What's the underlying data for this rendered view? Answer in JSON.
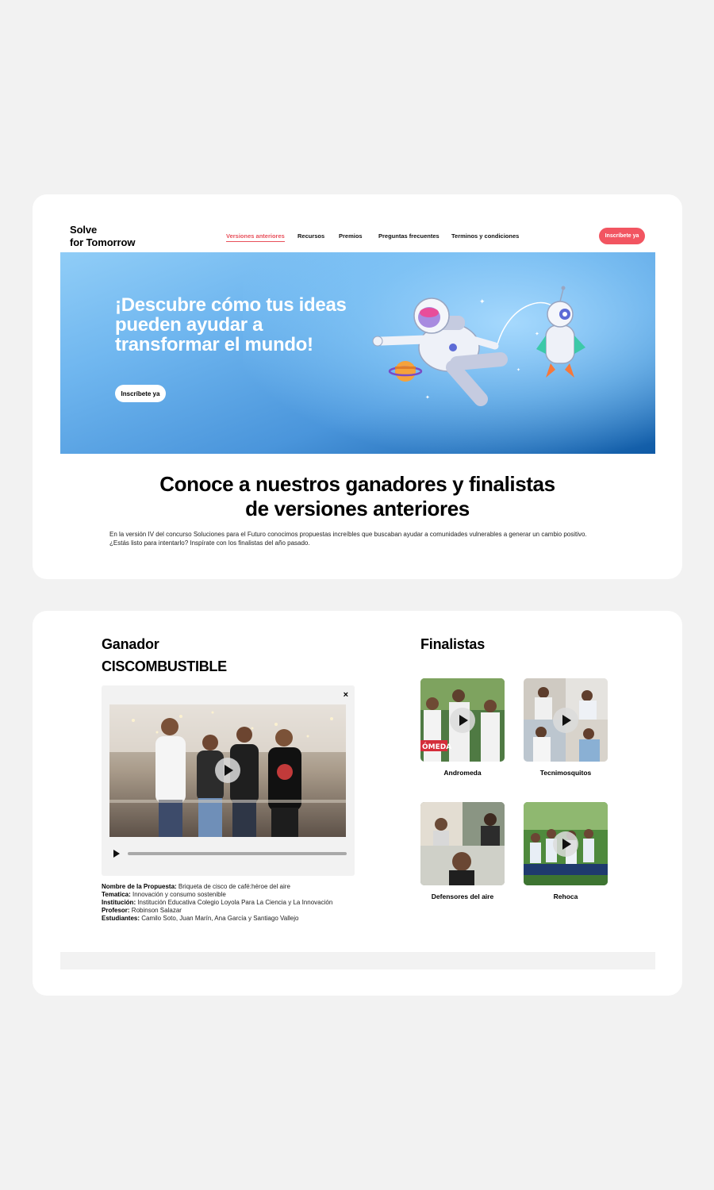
{
  "header": {
    "logo_line1": "Solve",
    "logo_line2": "for Tomorrow",
    "nav": [
      {
        "label": "Versiones anteriores",
        "active": true
      },
      {
        "label": "Recursos",
        "active": false
      },
      {
        "label": "Premios",
        "active": false
      },
      {
        "label": "Preguntas frecuentes",
        "active": false
      },
      {
        "label": "Terminos y condiciones",
        "active": false
      }
    ],
    "cta_label": "Inscríbete ya"
  },
  "hero": {
    "title": "¡Descubre cómo tus ideas pueden ayudar a transformar el mundo!",
    "button_label": "Inscríbete ya"
  },
  "section": {
    "title_line1": "Conoce a nuestros ganadores y finalistas",
    "title_line2": "de versiones anteriores",
    "intro_line1": "En la versión IV del concurso Soluciones para el Futuro conocimos propuestas increíbles que buscaban ayudar a comunidades vulnerables a generar un cambio positivo.",
    "intro_line2": "¿Estás listo para intentarlo? Inspírate con los finalistas del año pasado."
  },
  "winner": {
    "heading": "Ganador",
    "name": "CISCOMBUSTIBLE",
    "close_icon": "×",
    "details": [
      {
        "label": "Nombre de la Propuesta:",
        "value": " Briqueta de cisco de café:héroe del aire"
      },
      {
        "label": "Tematica:",
        "value": " Innovación y consumo sostenible"
      },
      {
        "label": "Institución:",
        "value": " Institución Educativa Colegio Loyola Para La Ciencia y La Innovación"
      },
      {
        "label": "Profesor:",
        "value": " Robinson Salazar"
      },
      {
        "label": "Estudiantes:",
        "value": " Camilo Soto, Juan Marín, Ana García y Santiago Vallejo"
      }
    ]
  },
  "finalists": {
    "heading": "Finalistas",
    "items": [
      {
        "name": "Andromeda",
        "overlay": "ÓMEDA"
      },
      {
        "name": "Tecnimosquitos"
      },
      {
        "name": "Defensores del aire"
      },
      {
        "name": "Rehoca"
      }
    ]
  },
  "colors": {
    "accent": "#f25561",
    "active_nav": "#e8505b",
    "hero_dark": "#0f5aa5",
    "hero_light": "#90cdf7"
  }
}
